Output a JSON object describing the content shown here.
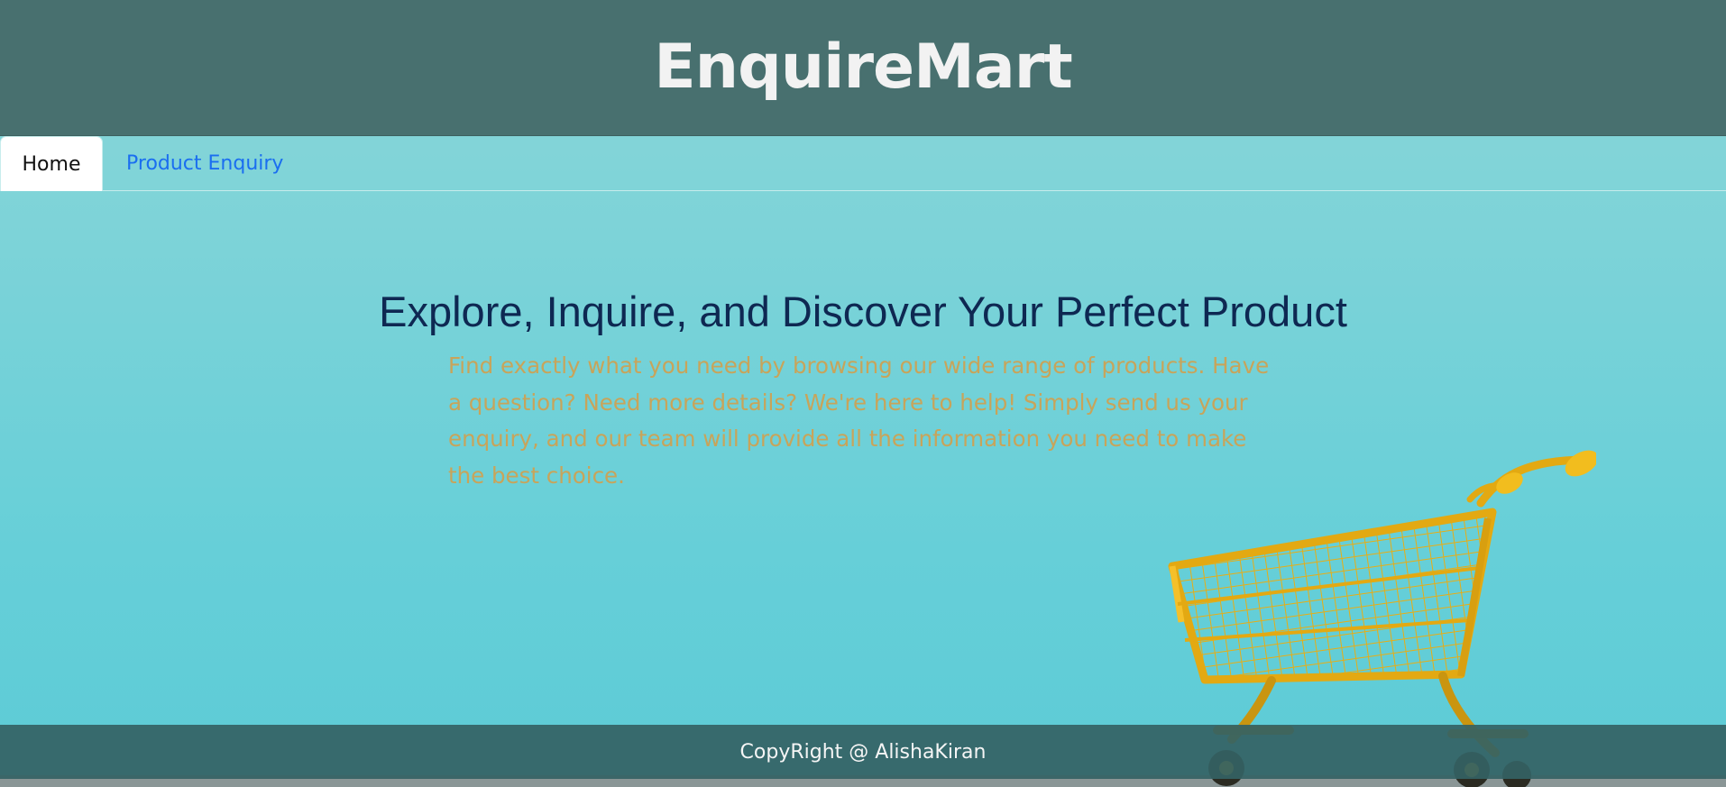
{
  "header": {
    "title": "EnquireMart"
  },
  "nav": {
    "tabs": [
      {
        "label": "Home",
        "active": true
      },
      {
        "label": "Product Enquiry",
        "active": false
      }
    ]
  },
  "hero": {
    "title": "Explore, Inquire, and Discover Your Perfect Product",
    "description": "Find exactly what you need by browsing our wide range of products. Have a question? Need more details? We're here to help! Simply send us your enquiry, and our team will provide all the information you need to make the best choice."
  },
  "background": {
    "image": "shopping-cart-icon"
  },
  "footer": {
    "copyright": "CopyRight @ AlishaKiran"
  },
  "colors": {
    "header_bg": "#48706f",
    "page_bg": "#7dd3d8",
    "title_color": "#0e2852",
    "description_color": "#c8a45a",
    "link_color": "#1a6ef0",
    "cart_color": "#f0b81e"
  }
}
